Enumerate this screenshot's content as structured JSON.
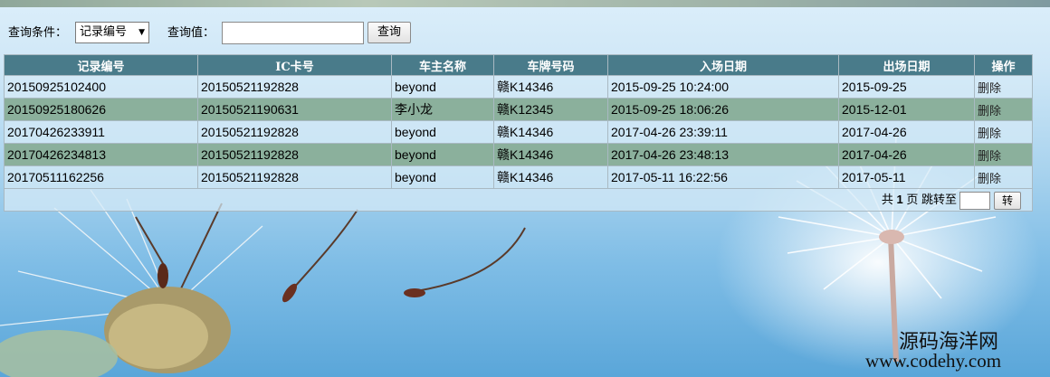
{
  "search": {
    "condition_label": "查询条件：",
    "condition_selected": "记录编号",
    "value_label": "查询值：",
    "value_input": "",
    "query_button": "查询"
  },
  "table": {
    "headers": [
      "记录编号",
      "IC卡号",
      "车主名称",
      "车牌号码",
      "入场日期",
      "出场日期",
      "操作"
    ],
    "rows": [
      [
        "20150925102400",
        "20150521192828",
        "beyond",
        "赣K14346",
        "2015-09-25 10:24:00",
        "2015-09-25",
        "删除"
      ],
      [
        "20150925180626",
        "20150521190631",
        "李小龙",
        "赣K12345",
        "2015-09-25 18:06:26",
        "2015-12-01",
        "删除"
      ],
      [
        "20170426233911",
        "20150521192828",
        "beyond",
        "赣K14346",
        "2017-04-26 23:39:11",
        "2017-04-26",
        "删除"
      ],
      [
        "20170426234813",
        "20150521192828",
        "beyond",
        "赣K14346",
        "2017-04-26 23:48:13",
        "2017-04-26",
        "删除"
      ],
      [
        "20170511162256",
        "20150521192828",
        "beyond",
        "赣K14346",
        "2017-05-11 16:22:56",
        "2017-05-11",
        "删除"
      ]
    ]
  },
  "pager": {
    "prefix": "共",
    "total_pages": "1",
    "suffix": "页 跳转至",
    "jump_value": "",
    "go_button": "转"
  },
  "watermark": {
    "line1": "源码海洋网",
    "line2": "www.codehy.com"
  },
  "colors": {
    "header_bg": "#497b8a",
    "row_highlight": "#8bb09c"
  }
}
